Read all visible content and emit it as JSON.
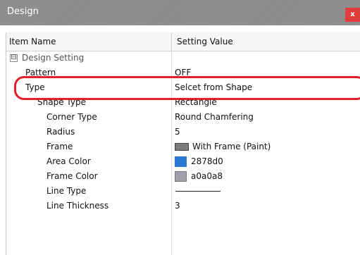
{
  "window": {
    "title": "Design",
    "close_label": "x"
  },
  "columns": {
    "name": "Item Name",
    "value": "Setting Value"
  },
  "group": {
    "expander": "⊟",
    "label": "Design Setting"
  },
  "rows": [
    {
      "name": "Pattern",
      "value": "OFF"
    },
    {
      "name": "Type",
      "value": "Selcet from Shape"
    },
    {
      "name": "Shape Type",
      "value": "Rectangle"
    },
    {
      "name": "Corner Type",
      "value": "Round Chamfering"
    },
    {
      "name": "Radius",
      "value": "5"
    },
    {
      "name": "Frame",
      "value": "With Frame (Paint)"
    },
    {
      "name": "Area Color",
      "value": "2878d0",
      "swatch": "#2878d0"
    },
    {
      "name": "Frame Color",
      "value": "a0a0a8",
      "swatch": "#a0a0a8"
    },
    {
      "name": "Line Type",
      "value": ""
    },
    {
      "name": "Line Thickness",
      "value": "3"
    }
  ],
  "colors": {
    "highlight": "#e0202c",
    "titlebar": "#8e8e8e",
    "close": "#e23d3d"
  }
}
